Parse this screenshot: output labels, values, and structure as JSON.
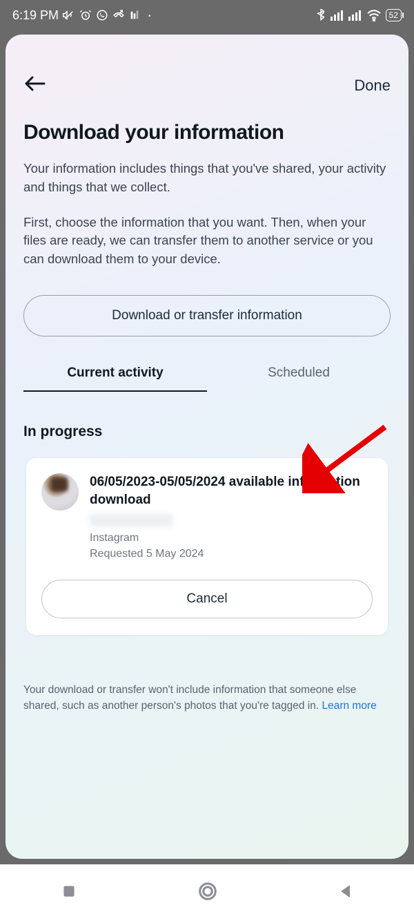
{
  "status": {
    "time": "6:19 PM",
    "battery": "52"
  },
  "header": {
    "done_label": "Done"
  },
  "page": {
    "title": "Download your information",
    "para1": "Your information includes things that you've shared, your activity and things that we collect.",
    "para2": "First, choose the information that you want. Then, when your files are ready, we can transfer them to another service or you can download them to your device.",
    "primary_button": "Download or transfer information"
  },
  "tabs": {
    "current": "Current activity",
    "scheduled": "Scheduled"
  },
  "section": {
    "heading": "In progress"
  },
  "download_item": {
    "title": "06/05/2023-05/05/2024 available information download",
    "platform": "Instagram",
    "requested": "Requested 5 May 2024",
    "cancel_label": "Cancel"
  },
  "disclaimer": {
    "text": "Your download or transfer won't include information that someone else shared, such as another person's photos that you're tagged in. ",
    "link": "Learn more"
  }
}
